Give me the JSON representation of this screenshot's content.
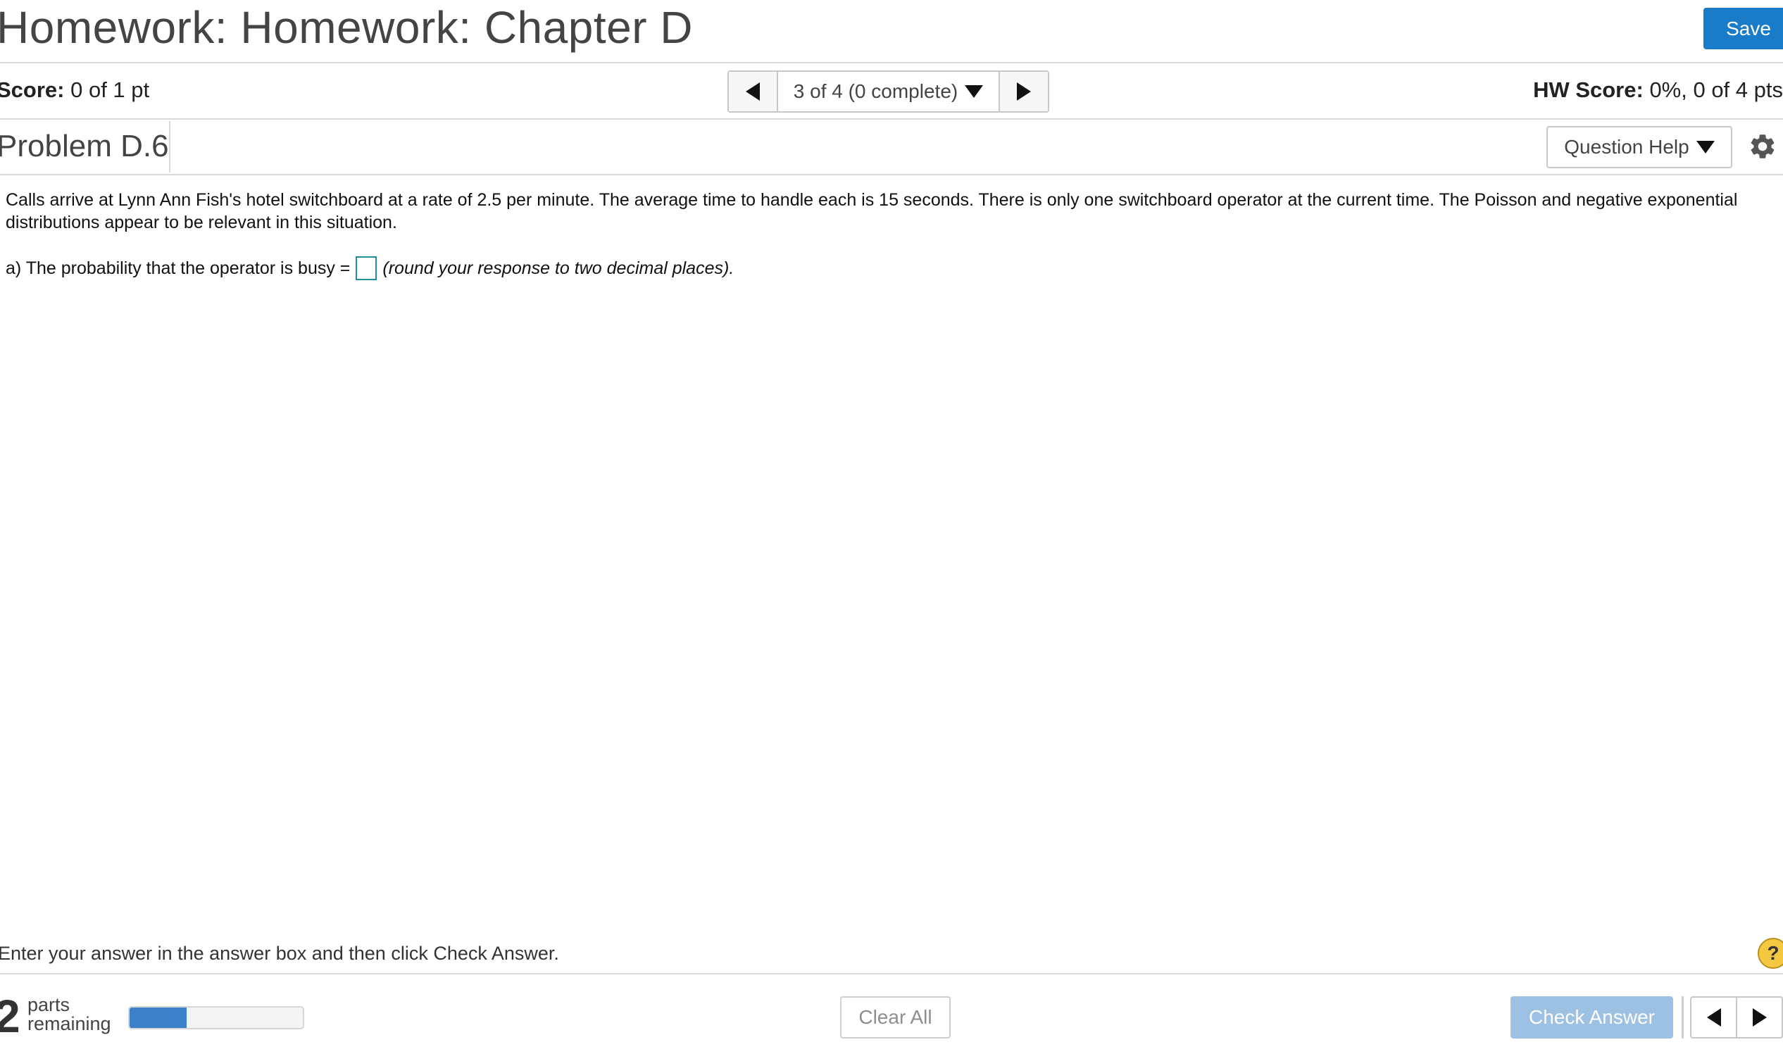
{
  "header": {
    "title": "Homework: Homework: Chapter D",
    "save_label": "Save"
  },
  "score_bar": {
    "score_label": "Score:",
    "score_value": "0 of 1 pt",
    "question_position": "3 of 4 (0 complete)",
    "hw_score_label": "HW Score:",
    "hw_score_value": "0%, 0 of 4 pts"
  },
  "problem": {
    "title": "Problem D.6",
    "question_help_label": "Question Help",
    "statement": "Calls arrive at Lynn Ann Fish's hotel switchboard at a rate of 2.5 per minute. The average time to handle each is 15 seconds.  There is only one switchboard operator at the current time. The Poisson and negative exponential distributions appear to be relevant in this situation.",
    "part_a_prefix": "a) The probability that the operator is busy =",
    "part_a_answer": "",
    "part_a_hint": "(round your response to two decimal places)."
  },
  "footer": {
    "instructions": "Enter your answer in the answer box and then click Check Answer.",
    "help_glyph": "?",
    "parts_count": "2",
    "parts_line1": "parts",
    "parts_line2": "remaining",
    "progress_fraction": 0.33,
    "clear_all_label": "Clear All",
    "check_answer_label": "Check Answer"
  },
  "colors": {
    "save_button_bg": "#1a7cc9",
    "progress_fill": "#3c80c9",
    "check_answer_bg": "#9dc1e3",
    "answer_box_border": "#1f8fa0",
    "help_icon_bg": "#f5c842"
  },
  "icons": {
    "prev": "triangle-left",
    "next": "triangle-right",
    "dropdown": "triangle-down",
    "settings": "gear",
    "help": "question-circle"
  }
}
